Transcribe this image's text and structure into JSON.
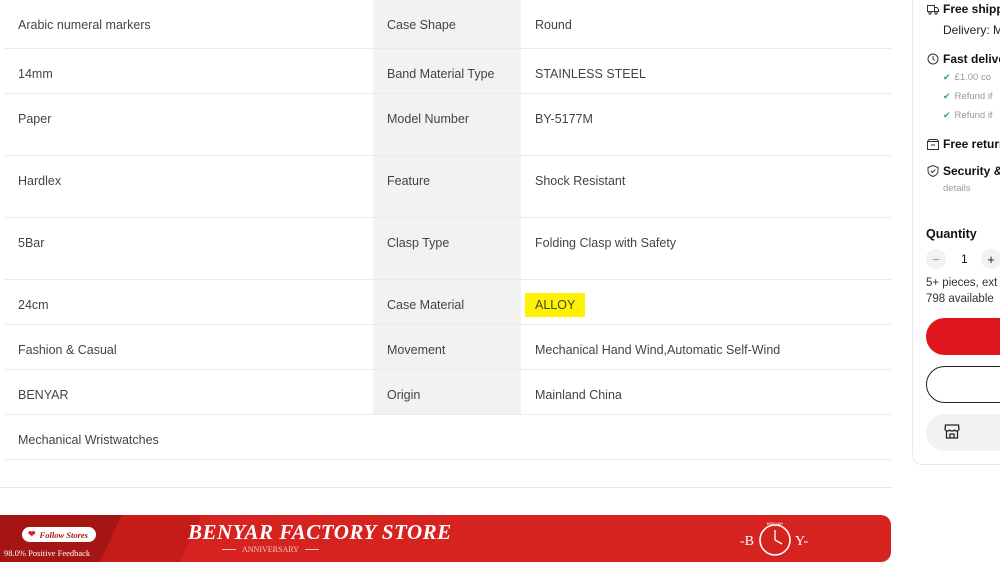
{
  "spec_rows": [
    {
      "value1": "Arabic numeral markers",
      "label2": "Case Shape",
      "value2": "Round"
    },
    {
      "value1": "14mm",
      "label2": "Band Material Type",
      "value2": "STAINLESS STEEL"
    },
    {
      "value1": "Paper",
      "label2": "Model Number",
      "value2": "BY-5177M"
    },
    {
      "value1": "Hardlex",
      "label2": "Feature",
      "value2": "Shock Resistant"
    },
    {
      "value1": "5Bar",
      "label2": "Clasp Type",
      "value2": "Folding Clasp with Safety"
    },
    {
      "value1": "24cm",
      "label2": "Case Material",
      "value2": "ALLOY"
    },
    {
      "value1": "Fashion & Casual",
      "label2": "Movement",
      "value2": "Mechanical Hand Wind,Automatic Self-Wind"
    },
    {
      "value1": "BENYAR",
      "label2": "Origin",
      "value2": "Mainland China"
    },
    {
      "value1": "Mechanical Wristwatches",
      "label2": "",
      "value2": ""
    }
  ],
  "highlight_color": "#fff200",
  "banner": {
    "follow_label": "Follow Stores",
    "feedback": "98.0% Positive Feedback",
    "store_name": "BENYAR FACTORY STORE",
    "tagline": "ANNIVERSARY",
    "logo_left": "-B",
    "logo_right": "Y-",
    "logo_small": "BENYAR",
    "color": "#d6231f"
  },
  "sidebar": {
    "free_shipping": "Free shipp",
    "delivery": "Delivery: M",
    "fast_delivery": "Fast delive",
    "fast_items": [
      "£1.00 co",
      "Refund if",
      "Refund if"
    ],
    "free_returns": "Free return",
    "security": "Security &",
    "security_sub": "details",
    "quantity_label": "Quantity",
    "quantity_value": "1",
    "minus": "−",
    "plus": "+",
    "pieces_note": "5+ pieces, ext",
    "available": "798 available",
    "buy_color": "#e0161f"
  }
}
